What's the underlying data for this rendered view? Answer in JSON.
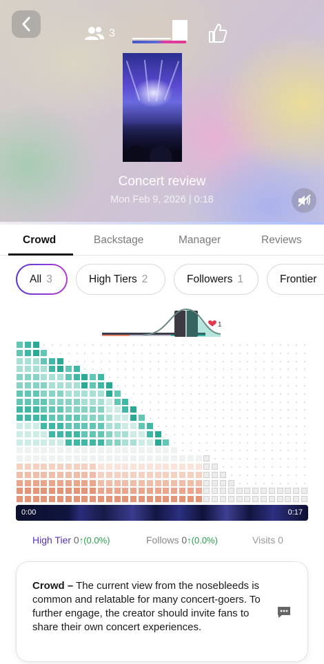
{
  "header": {
    "people_count": "3",
    "title": "Concert review",
    "subtitle": "Mon Feb 9, 2026 | 0:18"
  },
  "tabs": [
    {
      "label": "Crowd",
      "active": true
    },
    {
      "label": "Backstage",
      "active": false
    },
    {
      "label": "Manager",
      "active": false
    },
    {
      "label": "Reviews",
      "active": false
    }
  ],
  "filters": [
    {
      "label": "All",
      "count": "3",
      "active": true
    },
    {
      "label": "High Tiers",
      "count": "2",
      "active": false
    },
    {
      "label": "Followers",
      "count": "1",
      "active": false
    },
    {
      "label": "Frontier",
      "count": "",
      "active": false
    }
  ],
  "mini_chart": {
    "reaction_count": "1"
  },
  "timeline": {
    "start": "0:00",
    "end": "0:17"
  },
  "stats": {
    "high_tier_label": "High Tier",
    "high_tier_value": "0",
    "high_tier_change": "↑(0.0%)",
    "follows_label": "Follows",
    "follows_value": "0",
    "follows_change": "↑(0.0%)",
    "visits_label": "Visits",
    "visits_value": "0"
  },
  "note": {
    "heading": "Crowd –",
    "body": "The current view from the nosebleeds is common and relatable for many concert-goers. To further engage, the creator should invite fans to share their own concert experiences."
  },
  "colors": {
    "accent_purple": "#5b35d5",
    "high_tier": "#5a2fc4",
    "positive_change": "#27a04a",
    "teal": "#2fb5a1",
    "salmon": "#e79a7f"
  },
  "icons": [
    "back-arrow-icon",
    "people-icon",
    "thumbs-up-icon",
    "mute-icon",
    "chat-bubble-icon",
    "heart-icon"
  ]
}
